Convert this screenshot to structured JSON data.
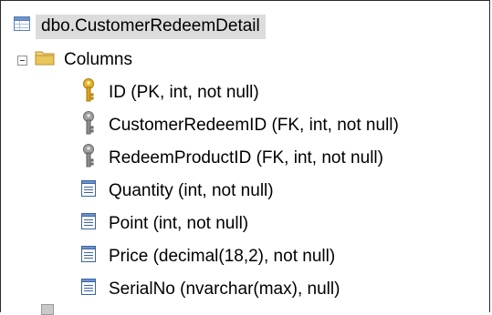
{
  "tree": {
    "table": {
      "label": "dbo.CustomerRedeemDetail",
      "icon": "table-icon"
    },
    "folder": {
      "label": "Columns",
      "icon": "folder-icon",
      "expanded": true
    },
    "columns": [
      {
        "label": "ID (PK, int, not null)",
        "icon": "primary-key-icon"
      },
      {
        "label": "CustomerRedeemID (FK, int, not null)",
        "icon": "foreign-key-icon"
      },
      {
        "label": "RedeemProductID (FK, int, not null)",
        "icon": "foreign-key-icon"
      },
      {
        "label": "Quantity (int, not null)",
        "icon": "column-icon"
      },
      {
        "label": "Point (int, not null)",
        "icon": "column-icon"
      },
      {
        "label": "Price (decimal(18,2), not null)",
        "icon": "column-icon"
      },
      {
        "label": "SerialNo (nvarchar(max), null)",
        "icon": "column-icon"
      }
    ]
  },
  "colors": {
    "selection": "#dcdcdc",
    "key_gold": "#d7a21a",
    "key_gray": "#8c8c8c",
    "folder": "#e8c65a",
    "column_icon": "#3a63a8"
  }
}
